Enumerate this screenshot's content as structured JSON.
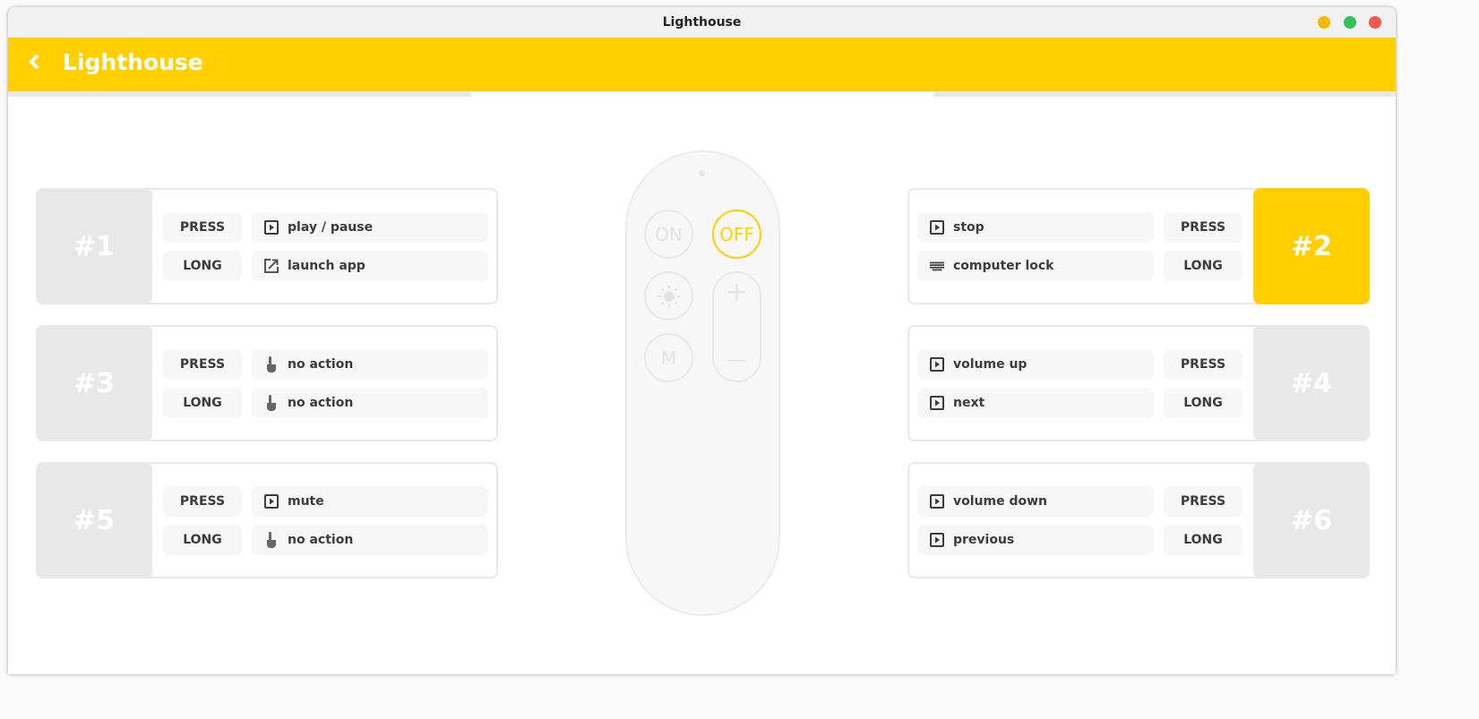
{
  "window": {
    "title": "Lighthouse"
  },
  "header": {
    "title": "Lighthouse",
    "back_icon": "chevron-left-icon"
  },
  "colors": {
    "accent": "#ffcf00",
    "inactive": "#e8e8e8"
  },
  "remote": {
    "on": "ON",
    "off": "OFF",
    "mode": "M",
    "plus": "+",
    "minus": "—",
    "active": "OFF"
  },
  "cards": [
    {
      "id": "#1",
      "selected": false,
      "rows": [
        {
          "label": "PRESS",
          "action": "play / pause",
          "icon": "media-icon"
        },
        {
          "label": "LONG",
          "action": "launch app",
          "icon": "launch-icon"
        }
      ]
    },
    {
      "id": "#2",
      "selected": true,
      "rows": [
        {
          "label": "PRESS",
          "action": "stop",
          "icon": "media-icon"
        },
        {
          "label": "LONG",
          "action": "computer lock",
          "icon": "keyboard-icon"
        }
      ]
    },
    {
      "id": "#3",
      "selected": false,
      "rows": [
        {
          "label": "PRESS",
          "action": "no action",
          "icon": "hand-icon"
        },
        {
          "label": "LONG",
          "action": "no action",
          "icon": "hand-icon"
        }
      ]
    },
    {
      "id": "#4",
      "selected": false,
      "rows": [
        {
          "label": "PRESS",
          "action": "volume up",
          "icon": "media-icon"
        },
        {
          "label": "LONG",
          "action": "next",
          "icon": "media-icon"
        }
      ]
    },
    {
      "id": "#5",
      "selected": false,
      "rows": [
        {
          "label": "PRESS",
          "action": "mute",
          "icon": "media-icon"
        },
        {
          "label": "LONG",
          "action": "no action",
          "icon": "hand-icon"
        }
      ]
    },
    {
      "id": "#6",
      "selected": false,
      "rows": [
        {
          "label": "PRESS",
          "action": "volume down",
          "icon": "media-icon"
        },
        {
          "label": "LONG",
          "action": "previous",
          "icon": "media-icon"
        }
      ]
    }
  ]
}
